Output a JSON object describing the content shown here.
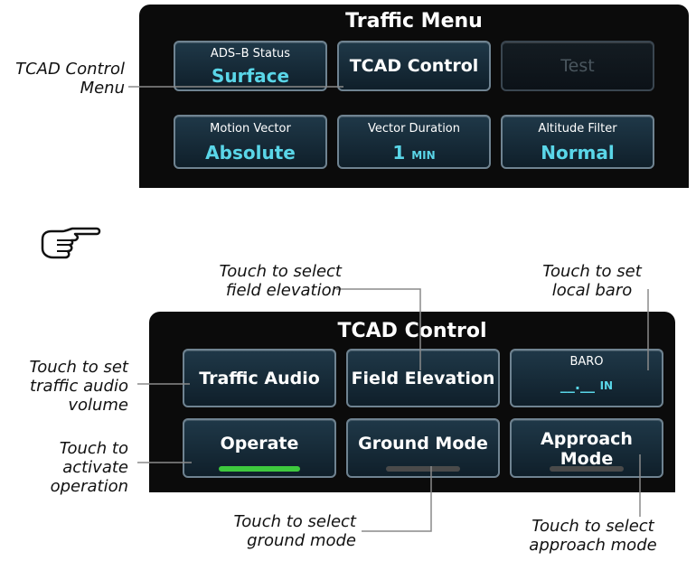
{
  "traffic_menu": {
    "title": "Traffic Menu",
    "buttons": {
      "ads_b": {
        "label": "ADS–B Status",
        "value": "Surface"
      },
      "tcad_control": {
        "label": "TCAD Control"
      },
      "test": {
        "label": "Test",
        "enabled": false
      },
      "motion_vector": {
        "label": "Motion Vector",
        "value": "Absolute"
      },
      "vector_duration": {
        "label": "Vector Duration",
        "value": "1",
        "unit": "MIN"
      },
      "altitude_filter": {
        "label": "Altitude Filter",
        "value": "Normal"
      }
    }
  },
  "tcad_control": {
    "title": "TCAD Control",
    "buttons": {
      "traffic_audio": {
        "label": "Traffic Audio"
      },
      "field_elevation": {
        "label": "Field Elevation"
      },
      "baro": {
        "label": "BARO",
        "value": "__.__",
        "unit": "IN"
      },
      "operate": {
        "label": "Operate",
        "active": true
      },
      "ground_mode": {
        "label": "Ground Mode",
        "active": false
      },
      "approach_mode": {
        "label": "Approach Mode",
        "active": false
      }
    }
  },
  "callouts": {
    "tcad_menu": [
      "TCAD Control",
      "Menu"
    ],
    "field_elevation": [
      "Touch to select",
      "field elevation"
    ],
    "local_baro": [
      "Touch to set",
      "local baro"
    ],
    "traffic_audio": [
      "Touch to set",
      "traffic audio",
      "volume"
    ],
    "activate": [
      "Touch to",
      "activate",
      "operation"
    ],
    "ground_mode": [
      "Touch to select",
      "ground mode"
    ],
    "approach_mode": [
      "Touch to select",
      "approach mode"
    ]
  },
  "icons": {
    "note": "pointing-hand-icon"
  },
  "colors": {
    "accent": "#5ad6e8",
    "active": "#3ec93e",
    "inactive": "#4a4a4a"
  }
}
